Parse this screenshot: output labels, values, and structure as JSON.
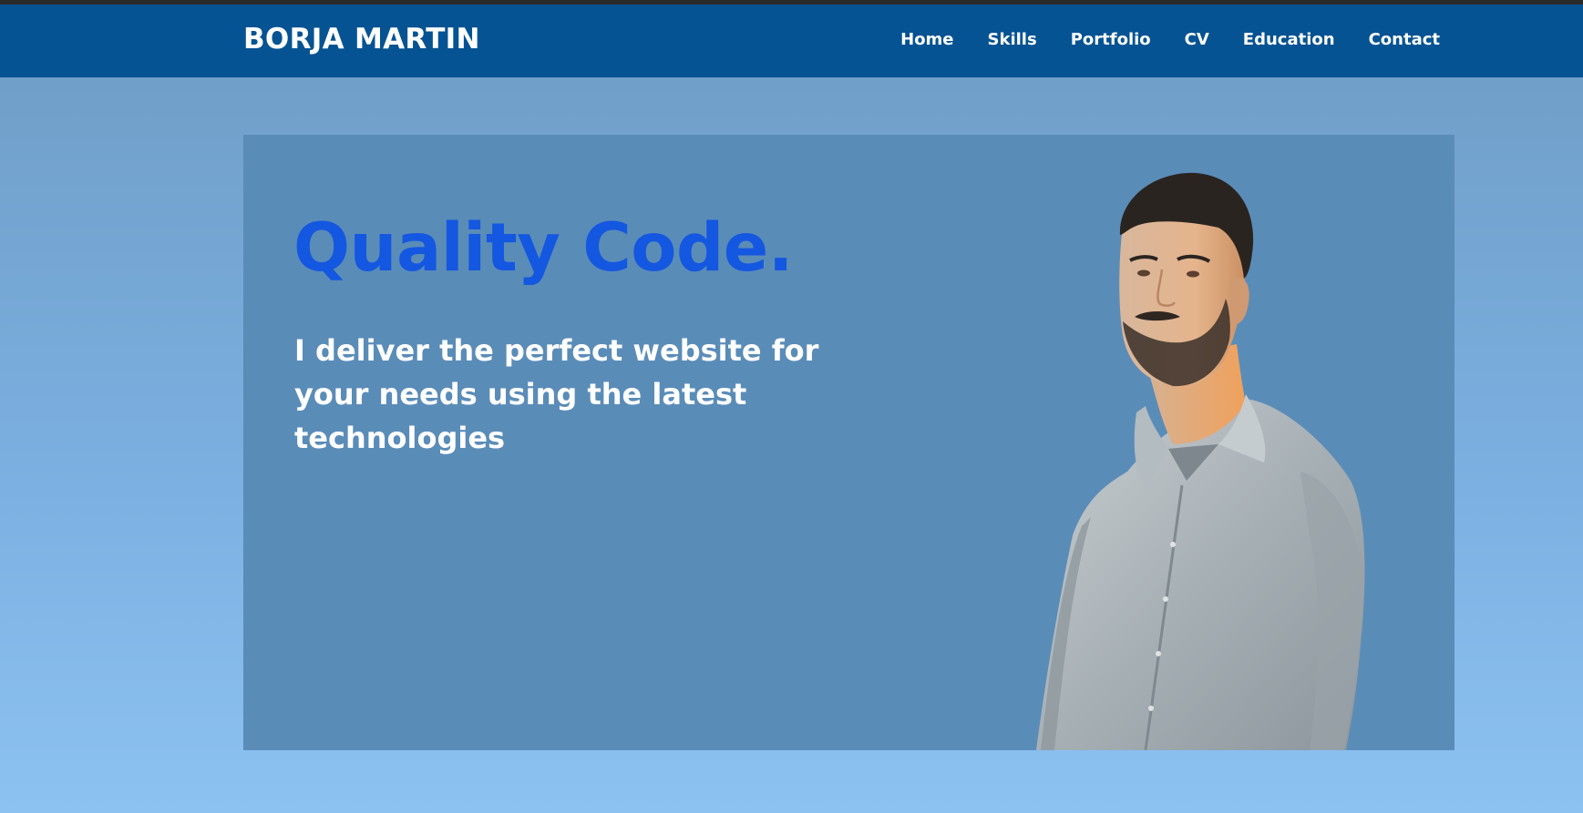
{
  "header": {
    "brand": "BORJA MARTIN",
    "nav": [
      {
        "label": "Home"
      },
      {
        "label": "Skills"
      },
      {
        "label": "Portfolio"
      },
      {
        "label": "CV"
      },
      {
        "label": "Education"
      },
      {
        "label": "Contact"
      }
    ]
  },
  "hero": {
    "headline": "Quality Code.",
    "tagline": "I deliver the perfect website for your needs using the latest technologies"
  },
  "colors": {
    "navbar": "#055392",
    "headline": "#1457e0",
    "hero_panel": "#5a8cb8"
  }
}
